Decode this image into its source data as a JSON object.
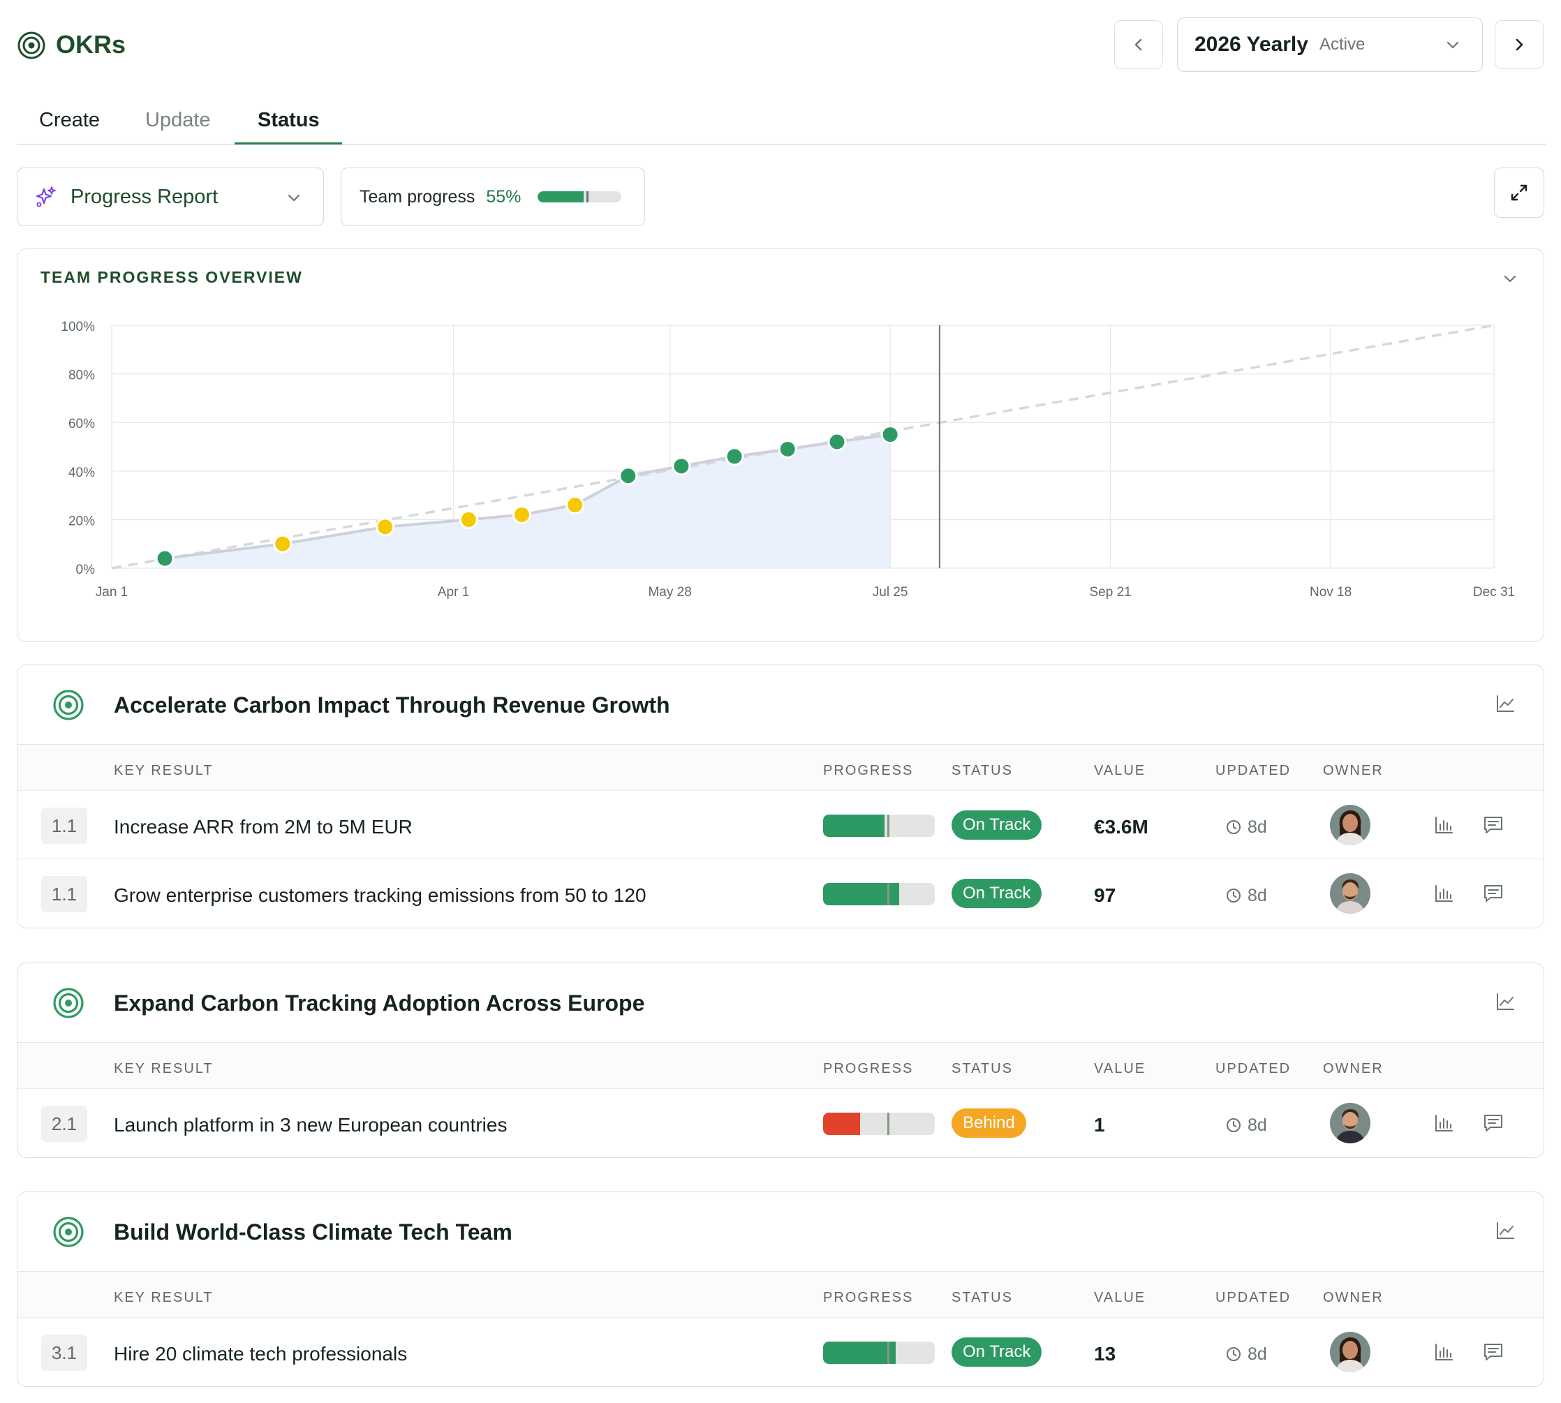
{
  "header": {
    "title": "OKRs",
    "period_title": "2026 Yearly",
    "period_status": "Active"
  },
  "tabs": [
    {
      "label": "Create",
      "active": false
    },
    {
      "label": "Update",
      "active": false
    },
    {
      "label": "Status",
      "active": true
    }
  ],
  "toolbar": {
    "report_label": "Progress Report",
    "team_progress_label": "Team progress",
    "team_progress_pct": "55%",
    "team_progress_value": 0.55
  },
  "overview": {
    "heading": "TEAM PROGRESS OVERVIEW"
  },
  "chart_data": {
    "type": "line",
    "title": "TEAM PROGRESS OVERVIEW",
    "x_ticks": [
      "Jan 1",
      "Apr 1",
      "May 28",
      "Jul 25",
      "Sep 21",
      "Nov 18",
      "Dec 31"
    ],
    "y_ticks": [
      "0%",
      "20%",
      "40%",
      "60%",
      "80%",
      "100%"
    ],
    "ylim": [
      0,
      100
    ],
    "xlim": [
      "Jan 1",
      "Dec 31"
    ],
    "today": "Aug 7",
    "series": [
      {
        "points": [
          {
            "x": "Jan 15",
            "y": 4,
            "status": "on-track"
          },
          {
            "x": "Feb 15",
            "y": 10,
            "status": "at-risk"
          },
          {
            "x": "Mar 14",
            "y": 17,
            "status": "at-risk"
          },
          {
            "x": "Apr 5",
            "y": 20,
            "status": "at-risk"
          },
          {
            "x": "Apr 19",
            "y": 22,
            "status": "at-risk"
          },
          {
            "x": "May 3",
            "y": 26,
            "status": "at-risk"
          },
          {
            "x": "May 17",
            "y": 38,
            "status": "on-track"
          },
          {
            "x": "May 31",
            "y": 42,
            "status": "on-track"
          },
          {
            "x": "Jun 14",
            "y": 46,
            "status": "on-track"
          },
          {
            "x": "Jun 28",
            "y": 49,
            "status": "on-track"
          },
          {
            "x": "Jul 11",
            "y": 52,
            "status": "on-track"
          },
          {
            "x": "Jul 25",
            "y": 55,
            "status": "on-track"
          }
        ]
      }
    ],
    "target_line": {
      "from": {
        "x": "Jan 1",
        "y": 0
      },
      "to": {
        "x": "Dec 31",
        "y": 100
      }
    },
    "colors": {
      "on_track": "#2e9a63",
      "at_risk": "#f5c800",
      "area": "#e8eefc",
      "target": "#d5d8dc"
    },
    "grid": true,
    "legend": "none"
  },
  "columns": {
    "key_result": "KEY RESULT",
    "progress": "PROGRESS",
    "status": "STATUS",
    "value": "VALUE",
    "updated": "UPDATED",
    "owner": "OWNER"
  },
  "objectives": [
    {
      "title": "Accelerate Carbon Impact Through Revenue Growth",
      "key_results": [
        {
          "num": "1.1",
          "title": "Increase ARR from 2M to 5M EUR",
          "progress": 0.55,
          "status": "On Track",
          "status_color": "#2e9a63",
          "value": "€3.6M",
          "updated": "8d",
          "owner_avatar": "female"
        },
        {
          "num": "1.1",
          "title": "Grow enterprise customers tracking emissions from 50 to 120",
          "progress": 0.68,
          "status": "On Track",
          "status_color": "#2e9a63",
          "value": "97",
          "updated": "8d",
          "owner_avatar": "male"
        }
      ]
    },
    {
      "title": "Expand Carbon Tracking Adoption Across Europe",
      "key_results": [
        {
          "num": "2.1",
          "title": "Launch platform in 3 new European countries",
          "progress": 0.33,
          "status": "Behind",
          "status_color": "#f5a623",
          "fill_color": "#e0432a",
          "value": "1",
          "updated": "8d",
          "owner_avatar": "male2"
        }
      ]
    },
    {
      "title": "Build World-Class Climate Tech Team",
      "key_results": [
        {
          "num": "3.1",
          "title": "Hire 20 climate tech professionals",
          "progress": 0.65,
          "status": "On Track",
          "status_color": "#2e9a63",
          "value": "13",
          "updated": "8d",
          "owner_avatar": "female"
        }
      ]
    }
  ]
}
